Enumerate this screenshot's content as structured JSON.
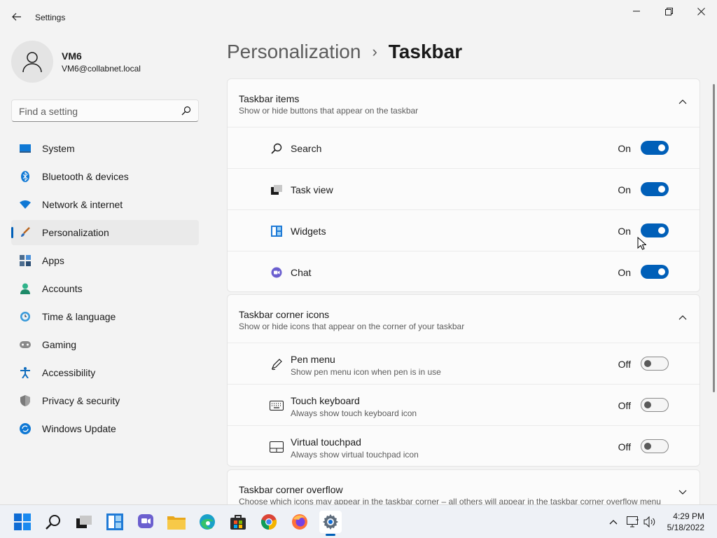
{
  "window": {
    "title": "Settings"
  },
  "profile": {
    "name": "VM6",
    "email": "VM6@collabnet.local"
  },
  "search": {
    "placeholder": "Find a setting"
  },
  "nav": [
    {
      "label": "System",
      "icon": "system-icon"
    },
    {
      "label": "Bluetooth & devices",
      "icon": "bluetooth-icon"
    },
    {
      "label": "Network & internet",
      "icon": "network-icon"
    },
    {
      "label": "Personalization",
      "icon": "brush-icon",
      "active": true
    },
    {
      "label": "Apps",
      "icon": "apps-icon"
    },
    {
      "label": "Accounts",
      "icon": "accounts-icon"
    },
    {
      "label": "Time & language",
      "icon": "clock-icon"
    },
    {
      "label": "Gaming",
      "icon": "gamepad-icon"
    },
    {
      "label": "Accessibility",
      "icon": "accessibility-icon"
    },
    {
      "label": "Privacy & security",
      "icon": "shield-icon"
    },
    {
      "label": "Windows Update",
      "icon": "update-icon"
    }
  ],
  "breadcrumb": {
    "parent": "Personalization",
    "separator": "›",
    "current": "Taskbar"
  },
  "taskbar_items": {
    "title": "Taskbar items",
    "subtitle": "Show or hide buttons that appear on the taskbar",
    "rows": [
      {
        "label": "Search",
        "state": "On",
        "icon": "search-icon"
      },
      {
        "label": "Task view",
        "state": "On",
        "icon": "task-view-icon"
      },
      {
        "label": "Widgets",
        "state": "On",
        "icon": "widgets-icon"
      },
      {
        "label": "Chat",
        "state": "On",
        "icon": "chat-icon"
      }
    ]
  },
  "corner_icons": {
    "title": "Taskbar corner icons",
    "subtitle": "Show or hide icons that appear on the corner of your taskbar",
    "rows": [
      {
        "label": "Pen menu",
        "sub": "Show pen menu icon when pen is in use",
        "state": "Off",
        "icon": "pen-icon"
      },
      {
        "label": "Touch keyboard",
        "sub": "Always show touch keyboard icon",
        "state": "Off",
        "icon": "keyboard-icon"
      },
      {
        "label": "Virtual touchpad",
        "sub": "Always show virtual touchpad icon",
        "state": "Off",
        "icon": "touchpad-icon"
      }
    ]
  },
  "corner_overflow": {
    "title": "Taskbar corner overflow",
    "subtitle": "Choose which icons may appear in the taskbar corner – all others will appear in the taskbar corner overflow menu"
  },
  "clock": {
    "time": "4:29 PM",
    "date": "5/18/2022"
  },
  "colors": {
    "accent": "#005fb8",
    "background": "#f3f3f3",
    "card": "#fbfbfb"
  }
}
